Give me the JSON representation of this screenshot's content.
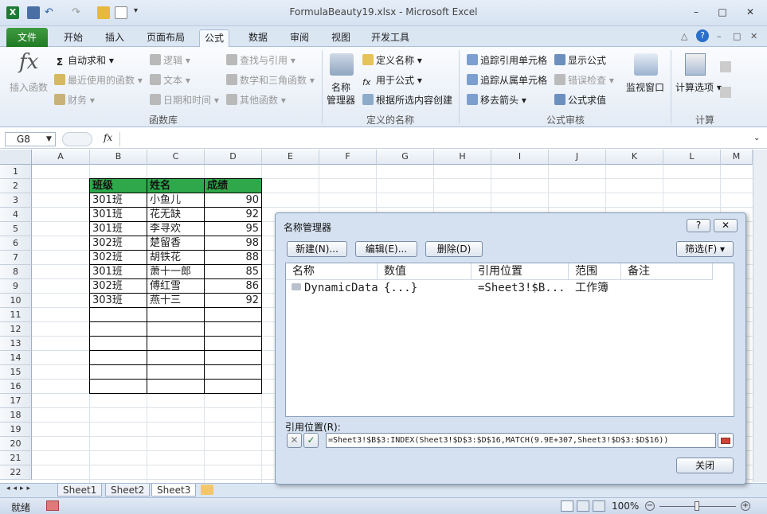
{
  "window": {
    "title": "FormulaBeauty19.xlsx - Microsoft Excel",
    "minimize": "–",
    "maximize": "□",
    "close": "✕"
  },
  "tabs": [
    "文件",
    "开始",
    "插入",
    "页面布局",
    "公式",
    "数据",
    "审阅",
    "视图",
    "开发工具"
  ],
  "ribbon": {
    "insert_function": "插入函数",
    "autosum": "自动求和",
    "recent": "最近使用的函数",
    "finance": "财务",
    "logic": "逻辑",
    "text": "文本",
    "datetime": "日期和时间",
    "lookup": "查找与引用",
    "math": "数学和三角函数",
    "other": "其他函数",
    "group_library": "函数库",
    "name_manager": "名称\n管理器",
    "name_manager_l1": "名称",
    "name_manager_l2": "管理器",
    "define_name": "定义名称",
    "use_in_formula": "用于公式",
    "create_from_selection": "根据所选内容创建",
    "group_names": "定义的名称",
    "trace_precedents": "追踪引用单元格",
    "trace_dependents": "追踪从属单元格",
    "remove_arrows": "移去箭头",
    "show_formulas": "显示公式",
    "error_check": "错误检查",
    "evaluate": "公式求值",
    "watch_window": "监视窗口",
    "group_audit": "公式审核",
    "calc_options": "计算选项",
    "group_calc": "计算"
  },
  "formula_bar": {
    "name_box": "G8",
    "fx": "fx",
    "formula": ""
  },
  "columns": [
    "A",
    "B",
    "C",
    "D",
    "E",
    "F",
    "G",
    "H",
    "I",
    "J",
    "K",
    "L",
    "M"
  ],
  "rows": [
    "1",
    "2",
    "3",
    "4",
    "5",
    "6",
    "7",
    "8",
    "9",
    "10",
    "11",
    "12",
    "13",
    "14",
    "15",
    "16",
    "17",
    "18",
    "19",
    "20",
    "21",
    "22"
  ],
  "table": {
    "headers": [
      "班级",
      "姓名",
      "成绩"
    ],
    "rows": [
      [
        "301班",
        "小鱼儿",
        "90"
      ],
      [
        "301班",
        "花无缺",
        "92"
      ],
      [
        "301班",
        "李寻欢",
        "95"
      ],
      [
        "302班",
        "楚留香",
        "98"
      ],
      [
        "302班",
        "胡铁花",
        "88"
      ],
      [
        "301班",
        "萧十一郎",
        "85"
      ],
      [
        "302班",
        "傅红雪",
        "86"
      ],
      [
        "303班",
        "燕十三",
        "92"
      ]
    ]
  },
  "sheets": [
    "Sheet1",
    "Sheet2",
    "Sheet3"
  ],
  "status": {
    "ready": "就绪",
    "zoom": "100%"
  },
  "dialog": {
    "title": "名称管理器",
    "help": "?",
    "close_x": "✕",
    "new": "新建(N)...",
    "edit": "编辑(E)...",
    "delete": "删除(D)",
    "filter": "筛选(F)",
    "columns": [
      "名称",
      "数值",
      "引用位置",
      "范围",
      "备注"
    ],
    "entry": {
      "name": "DynamicData",
      "value": "{...}",
      "refers_to": "=Sheet3!$B...",
      "scope": "工作簿",
      "comment": ""
    },
    "refers_label": "引用位置(R):",
    "refers_formula": "=Sheet3!$B$3:INDEX(Sheet3!$D$3:$D$16,MATCH(9.9E+307,Sheet3!$D$3:$D$16))",
    "close_button": "关闭"
  }
}
